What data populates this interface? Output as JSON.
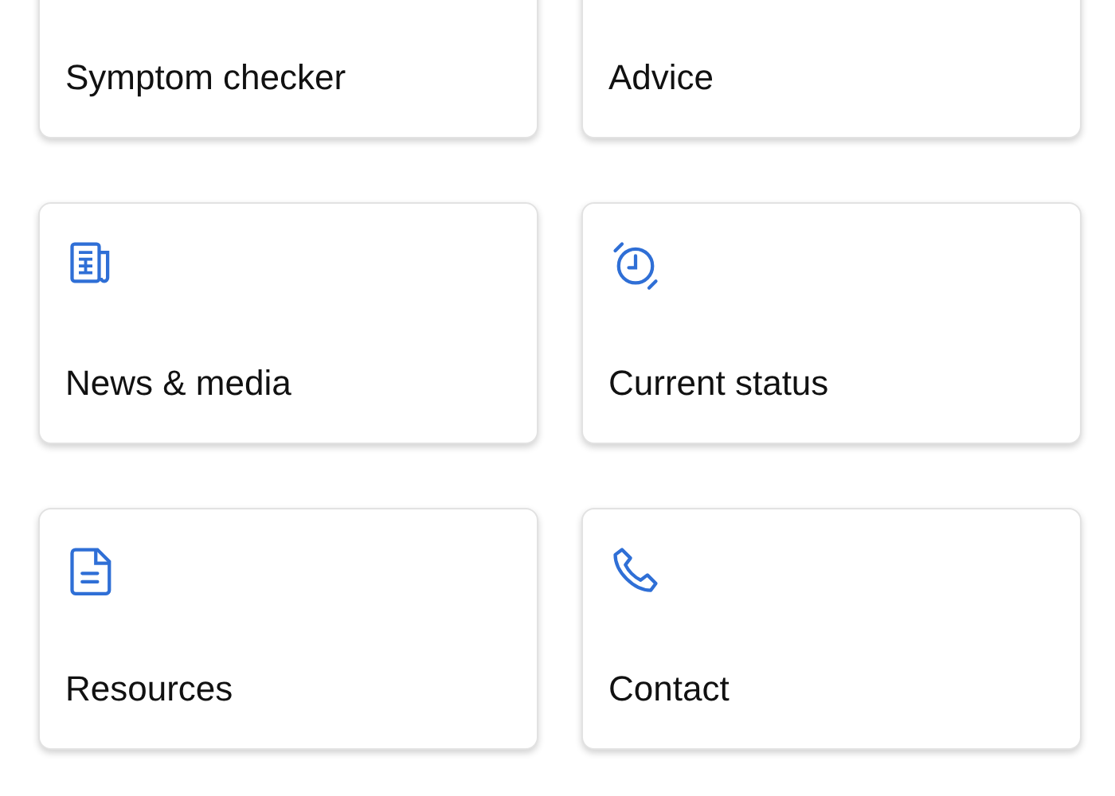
{
  "cards": [
    {
      "label": "Symptom checker"
    },
    {
      "label": "Advice"
    },
    {
      "label": "News & media"
    },
    {
      "label": "Current status"
    },
    {
      "label": "Resources"
    },
    {
      "label": "Contact"
    }
  ]
}
